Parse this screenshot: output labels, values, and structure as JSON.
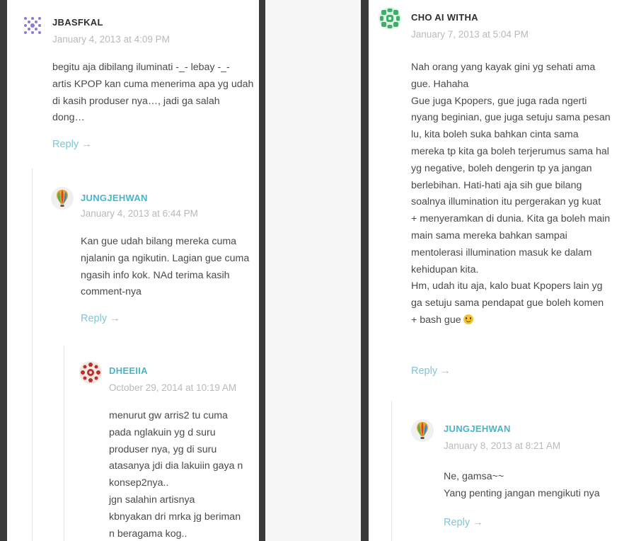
{
  "colors": {
    "accent": "#45b6c9",
    "author_dark": "#2f2f2f",
    "date": "#b9b9b9",
    "reply": "#7fc6d8"
  },
  "left_column": {
    "comments": [
      {
        "author": "JBASFKAL",
        "date": "January 4, 2013 at 4:09 PM",
        "lines": [
          "begitu aja dibilang iluminati -_- lebay -_-",
          "artis KPOP kan cuma menerima apa yg udah",
          "di kasih produser nya…, jadi ga salah",
          "dong…"
        ],
        "reply": "Reply →",
        "avatar_icon": "purple-dots-identicon"
      },
      {
        "author": "JUNGJEHWAN",
        "date": "January 4, 2013 at 6:44 PM",
        "lines": [
          "Kan gue udah bilang mereka cuma",
          "njalanin ga ngikutin. Lagian gue cuma",
          "ngasih info kok. NAd terima kasih",
          "comment-nya"
        ],
        "reply": "Reply →",
        "avatar_icon": "hot-air-balloon-avatar"
      },
      {
        "author": "DHEEIIA",
        "date": "October 29, 2014 at 10:19 AM",
        "lines": [
          "menurut gw arris2 tu cuma",
          "pada nglakuin yg d suru",
          "produser nya, yg di suru",
          "atasanya jdi dia lakuiin gaya n",
          "konsep2nya..",
          "jgn salahin artisnya",
          "kbnyakan dri mrka jg beriman",
          "n beragama kog.."
        ],
        "avatar_icon": "red-pattern-identicon"
      }
    ]
  },
  "right_column": {
    "comments": [
      {
        "author": "CHO AI WITHA",
        "date": "January 7, 2013 at 5:04 PM",
        "lines": [
          "Nah orang yang kayak gini yg sehati ama",
          "gue. Hahaha",
          "Gue juga Kpopers, gue juga rada ngerti",
          "nyang beginian, gue juga setuju sama pesan",
          "lu, kita boleh suka bahkan cinta sama",
          "mereka tp kita ga boleh terjerumus sama hal",
          "yg negative, boleh dengerin tp ya jangan",
          "berlebihan. Hati-hati aja sih gue bilang",
          "soalnya illumination itu pergerakan yg kuat",
          "+ menyeramkan di dunia. Kita ga boleh main",
          "main sama mereka bahkan sampai",
          "mentolerasi illumination masuk ke dalam",
          "kehidupan kita.",
          "Hm, udah itu aja, kalo buat Kpopers lain yg",
          "ga setuju sama pendapat gue boleh komen",
          "+ bash gue"
        ],
        "emoji": "smiley-emoji",
        "reply": "Reply →",
        "avatar_icon": "green-pattern-identicon"
      },
      {
        "author": "JUNGJEHWAN",
        "date": "January 8, 2013 at 8:21 AM",
        "lines": [
          "Ne, gamsa~~",
          "Yang penting jangan mengikuti nya"
        ],
        "reply": "Reply →",
        "avatar_icon": "hot-air-balloon-avatar"
      }
    ]
  }
}
